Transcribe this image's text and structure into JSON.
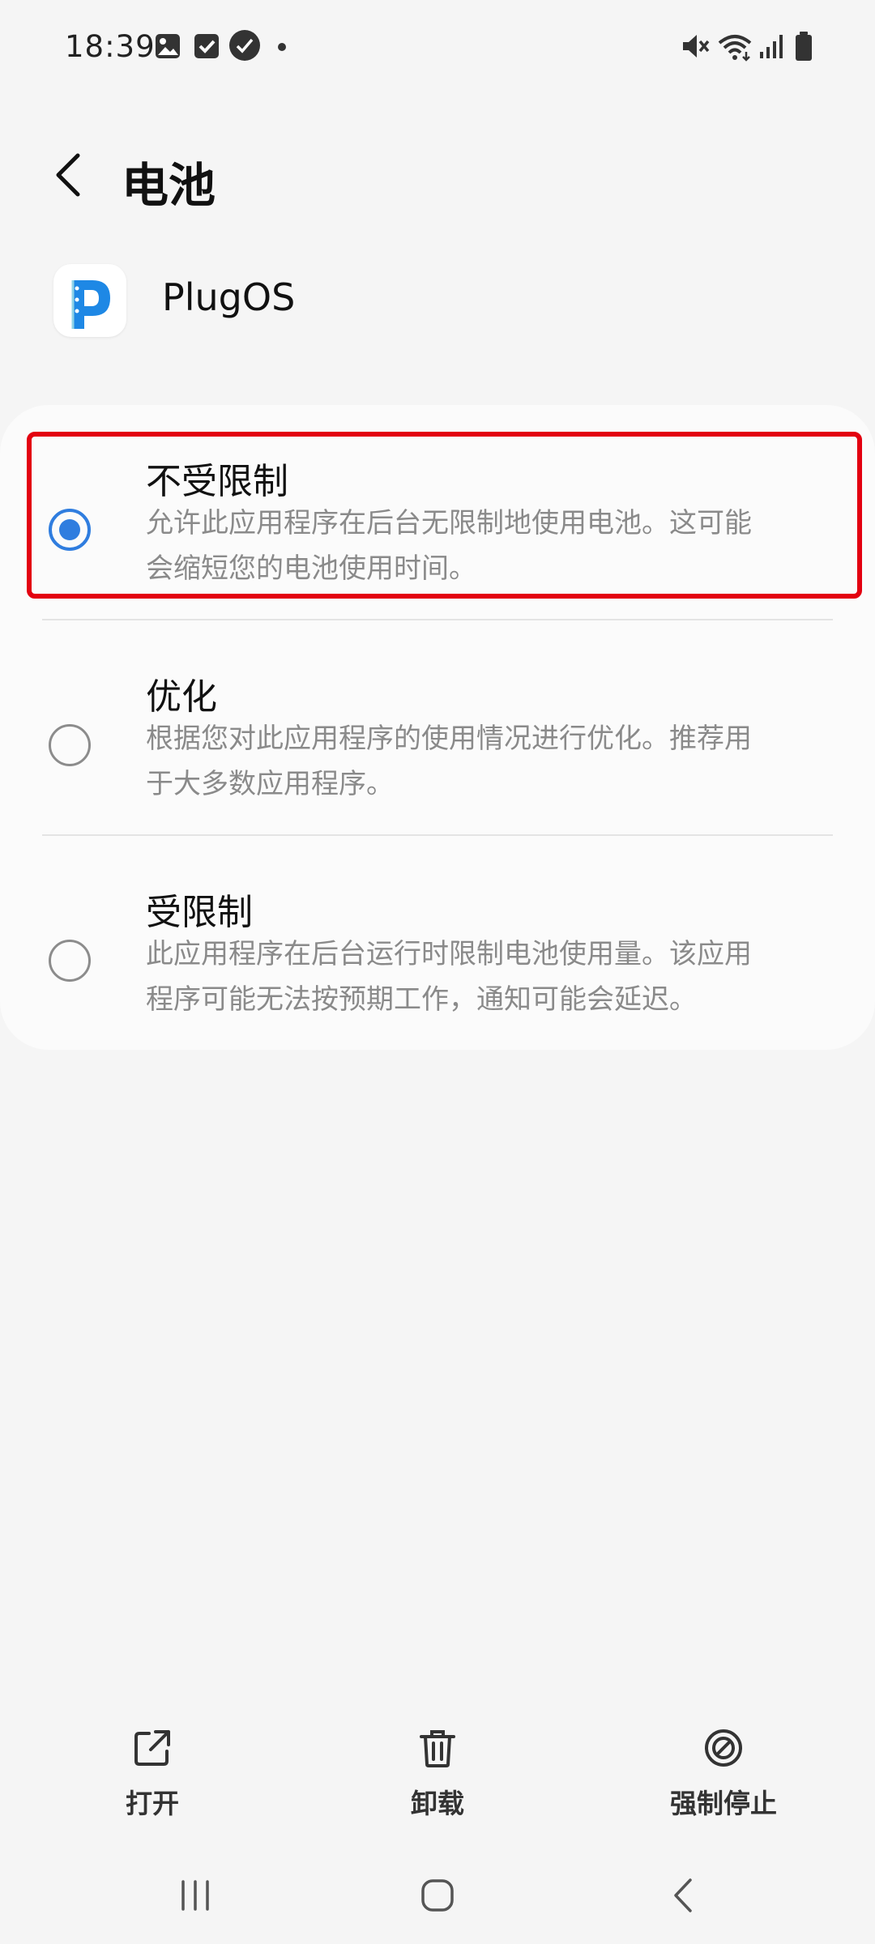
{
  "status_bar": {
    "time": "18:39",
    "left_icons": [
      "gallery-icon",
      "checkbox-icon",
      "app-notification-icon",
      "dot-icon"
    ],
    "right_icons": [
      "mute-icon",
      "wifi-icon",
      "signal-icon",
      "battery-icon"
    ]
  },
  "header": {
    "back_icon": "chevron-left-icon",
    "title": "电池"
  },
  "app": {
    "name": "PlugOS",
    "icon_letter": "P",
    "accent": "#1e88e5"
  },
  "options": [
    {
      "title": "不受限制",
      "description": "允许此应用程序在后台无限制地使用电池。这可能会缩短您的电池使用时间。",
      "selected": true
    },
    {
      "title": "优化",
      "description": "根据您对此应用程序的使用情况进行优化。推荐用于大多数应用程序。",
      "selected": false
    },
    {
      "title": "受限制",
      "description": "此应用程序在后台运行时限制电池使用量。该应用程序可能无法按预期工作，通知可能会延迟。",
      "selected": false
    }
  ],
  "bottom_actions": [
    {
      "label": "打开",
      "icon": "open-external-icon"
    },
    {
      "label": "卸载",
      "icon": "trash-icon"
    },
    {
      "label": "强制停止",
      "icon": "block-icon"
    }
  ],
  "nav_bar": {
    "items": [
      "recent-apps-icon",
      "home-icon",
      "back-icon"
    ]
  },
  "colors": {
    "background": "#f5f5f5",
    "card": "#fbfbfb",
    "radio_selected": "#2f7ddf",
    "highlight": "#e30010",
    "description_text": "#8a8a8a"
  }
}
